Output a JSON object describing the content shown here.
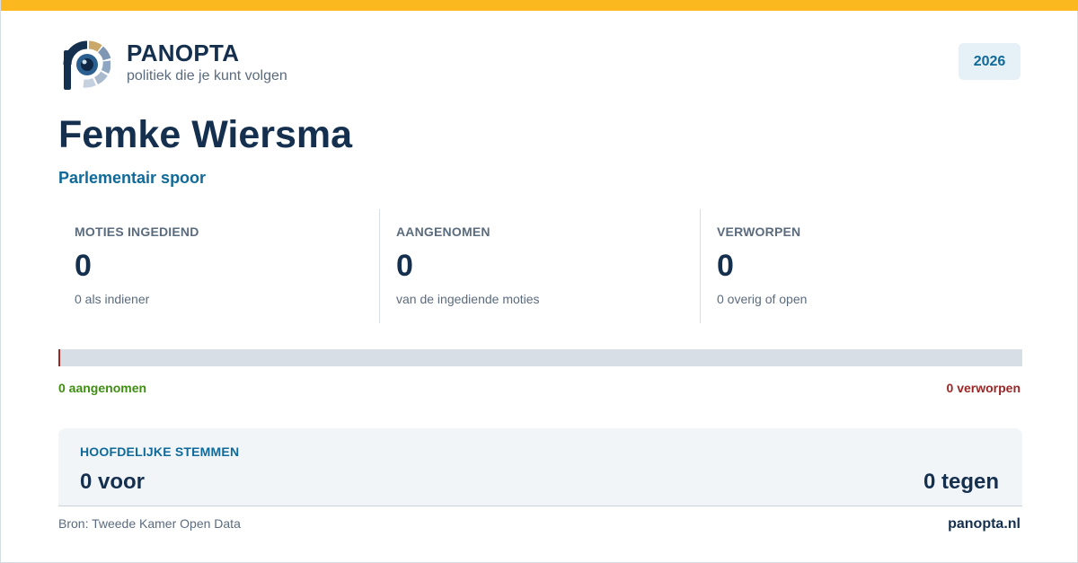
{
  "brand": {
    "name": "PANOPTA",
    "tagline": "politiek die je kunt volgen",
    "accent_color": "#fbb91f"
  },
  "year_badge": "2026",
  "person": {
    "name": "Femke Wiersma",
    "track": "Parlementair spoor"
  },
  "stats": [
    {
      "label": "MOTIES INGEDIEND",
      "value": "0",
      "sub": "0 als indiener"
    },
    {
      "label": "AANGENOMEN",
      "value": "0",
      "sub": "van de ingediende moties"
    },
    {
      "label": "VERWORPEN",
      "value": "0",
      "sub": "0 overig of open"
    }
  ],
  "progress": {
    "accepted_fraction": 0,
    "accepted_label": "0 aangenomen",
    "rejected_label": "0 verworpen",
    "accepted_color": "#3e8e12",
    "rejected_color": "#9b2626"
  },
  "votes": {
    "label": "HOOFDELIJKE STEMMEN",
    "for": "0 voor",
    "against": "0 tegen"
  },
  "footer": {
    "source": "Bron: Tweede Kamer Open Data",
    "site": "panopta.nl"
  }
}
